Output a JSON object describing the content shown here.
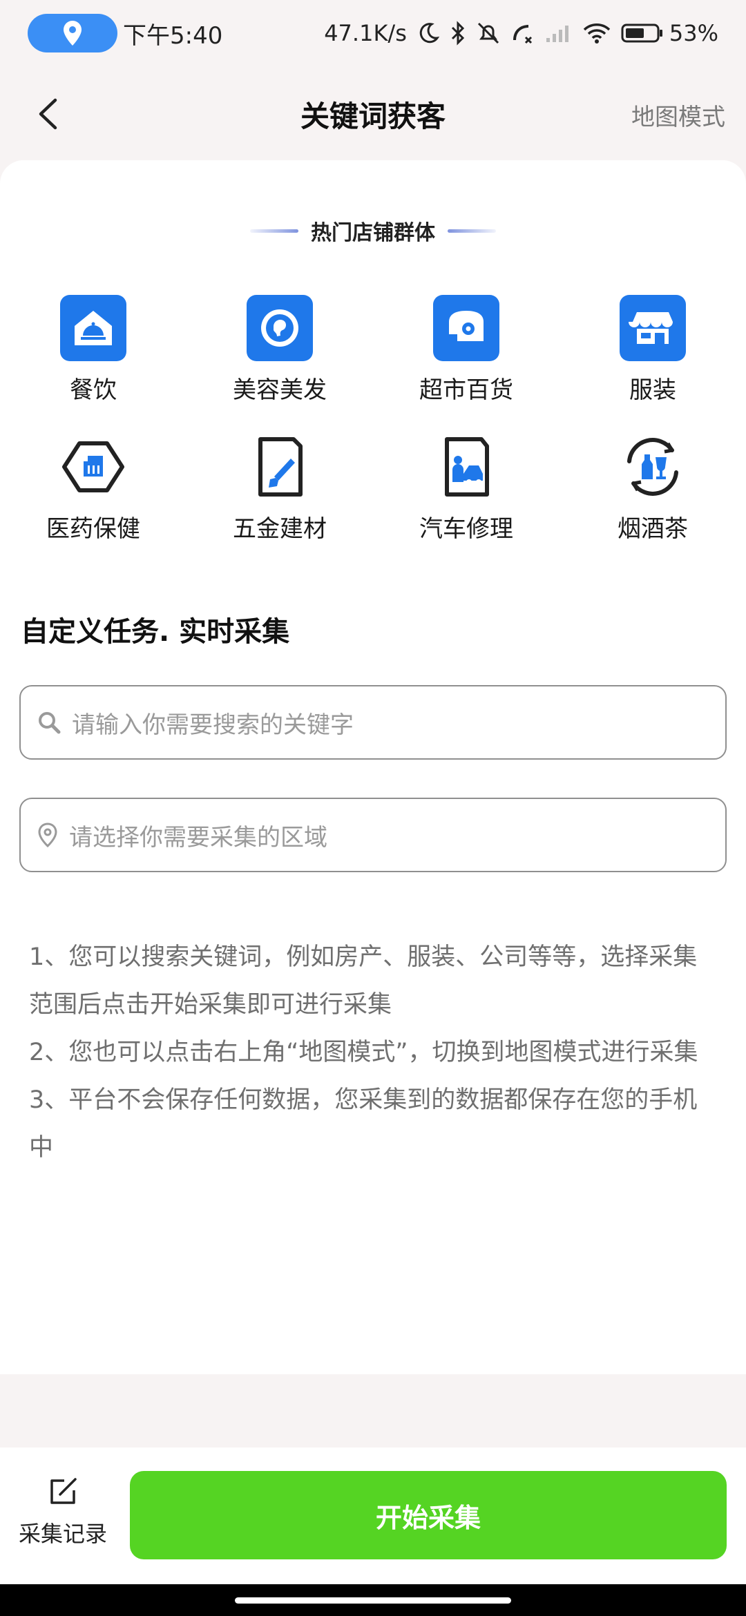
{
  "status_bar": {
    "time": "下午5:40",
    "net_speed": "47.1K/s",
    "battery": "53%"
  },
  "header": {
    "title": "关键词获客",
    "map_mode": "地图模式"
  },
  "hot_section": {
    "heading": "热门店铺群体",
    "categories": [
      {
        "label": "餐饮",
        "icon": "dining-icon"
      },
      {
        "label": "美容美发",
        "icon": "beauty-icon"
      },
      {
        "label": "超市百货",
        "icon": "supermarket-icon"
      },
      {
        "label": "服装",
        "icon": "clothing-store-icon"
      },
      {
        "label": "医药保健",
        "icon": "medicine-icon"
      },
      {
        "label": "五金建材",
        "icon": "hardware-icon"
      },
      {
        "label": "汽车修理",
        "icon": "car-repair-icon"
      },
      {
        "label": "烟酒茶",
        "icon": "tobacco-wine-tea-icon"
      }
    ]
  },
  "custom_task": {
    "title": "自定义任务. 实时采集",
    "keyword_placeholder": "请输入你需要搜索的关键字",
    "area_placeholder": "请选择你需要采集的区域"
  },
  "help": {
    "lines": [
      "1、您可以搜索关键词，例如房产、服装、公司等等，选择采集范围后点击开始采集即可进行采集",
      " 2、您也可以点击右上角“地图模式”，切换到地图模式进行采集",
      " 3、平台不会保存任何数据，您采集到的数据都保存在您的手机中"
    ]
  },
  "bottom": {
    "records_label": "采集记录",
    "start_label": "开始采集"
  },
  "colors": {
    "accent_blue": "#1f78ea",
    "start_green": "#55d423",
    "location_pill": "#3b8ff5"
  }
}
